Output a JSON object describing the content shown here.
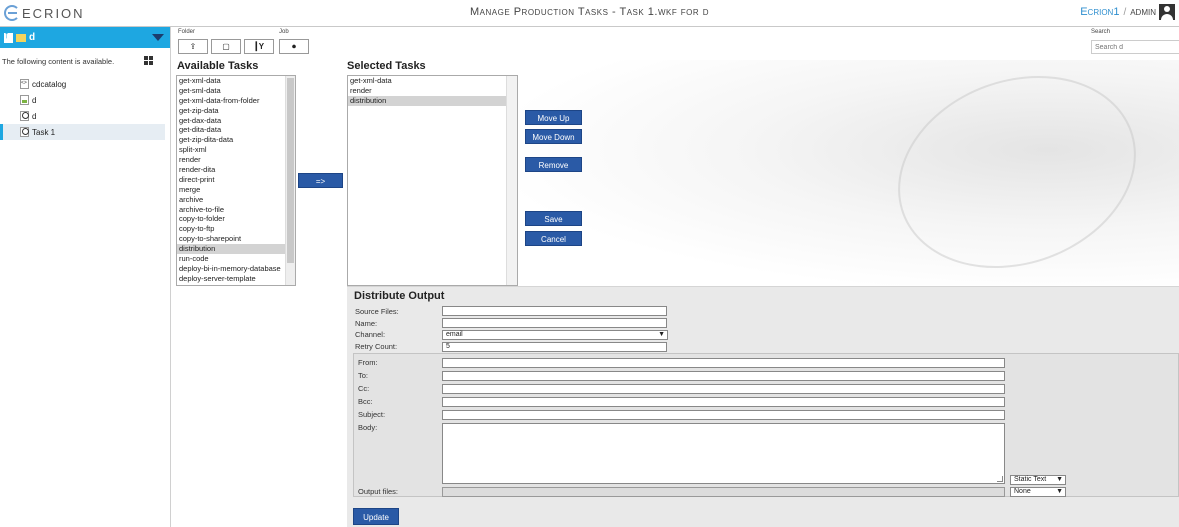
{
  "brand": {
    "logo_text": "ECRION"
  },
  "app": {
    "title": "Manage Production Tasks - Task 1.wkf for d"
  },
  "user": {
    "org": "Ecrion1",
    "separator": "/",
    "name": "admin"
  },
  "sidebar": {
    "header": {
      "folder_name": "d"
    },
    "info_text": "The following content is available.",
    "items": [
      {
        "label": "cdcatalog",
        "icon": "xml-file-icon"
      },
      {
        "label": "d",
        "icon": "document-file-icon"
      },
      {
        "label": "d",
        "icon": "workflow-file-icon"
      },
      {
        "label": "Task 1",
        "icon": "workflow-file-icon",
        "selected": true
      }
    ]
  },
  "toolbar": {
    "folder_label": "Folder",
    "job_label": "Job",
    "search_label": "Search",
    "search_placeholder": "Search d"
  },
  "available": {
    "title": "Available Tasks",
    "items": [
      "get-xml-data",
      "get-sml-data",
      "get-xml-data-from-folder",
      "get-zip-data",
      "get-dax-data",
      "get-dita-data",
      "get-zip-dita-data",
      "split-xml",
      "render",
      "render-dita",
      "direct-print",
      "merge",
      "archive",
      "archive-to-file",
      "copy-to-folder",
      "copy-to-ftp",
      "copy-to-sharepoint",
      "distribution",
      "run-code",
      "deploy-bi-in-memory-database",
      "deploy-server-template"
    ],
    "selected": "distribution"
  },
  "add_button": {
    "label": "=>"
  },
  "selected_tasks": {
    "title": "Selected Tasks",
    "items": [
      "get-xml-data",
      "render",
      "distribution"
    ],
    "selected": "distribution"
  },
  "actions": {
    "move_up": "Move Up",
    "move_down": "Move Down",
    "remove": "Remove",
    "save": "Save",
    "cancel": "Cancel"
  },
  "distribute": {
    "title": "Distribute Output",
    "source_files_label": "Source Files:",
    "source_files_value": "",
    "name_label": "Name:",
    "name_value": "",
    "channel_label": "Channel:",
    "channel_value": "email",
    "retry_label": "Retry Count:",
    "retry_value": "5",
    "email": {
      "from_label": "From:",
      "to_label": "To:",
      "cc_label": "Cc:",
      "bcc_label": "Bcc:",
      "subject_label": "Subject:",
      "body_label": "Body:",
      "body_mode": "Static Text",
      "output_files_label": "Output files:",
      "output_mode": "None"
    },
    "update_label": "Update"
  }
}
